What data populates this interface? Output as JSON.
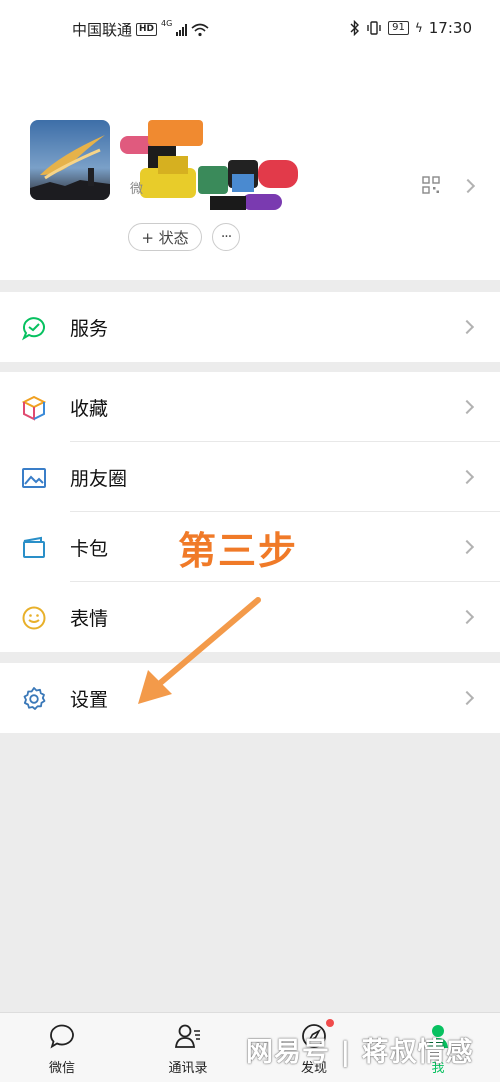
{
  "status_bar": {
    "carrier": "中国联通",
    "hd": "HD",
    "network": "4G",
    "battery": "91",
    "time": "17:30"
  },
  "profile": {
    "id_prefix": "微",
    "status_label": "+ 状态",
    "more_label": "···"
  },
  "menu": {
    "service": "服务",
    "favorites": "收藏",
    "moments": "朋友圈",
    "cards": "卡包",
    "stickers": "表情",
    "settings": "设置"
  },
  "annotation": {
    "text": "第三步",
    "color": "#f07a28"
  },
  "tabs": [
    {
      "label": "微信",
      "icon": "chat-icon"
    },
    {
      "label": "通讯录",
      "icon": "contacts-icon"
    },
    {
      "label": "发现",
      "icon": "compass-icon"
    },
    {
      "label": "我",
      "icon": "me-icon"
    }
  ],
  "watermark": "网易号 | 蒋叔情感",
  "colors": {
    "accent": "#07c160",
    "background": "#ececec"
  }
}
